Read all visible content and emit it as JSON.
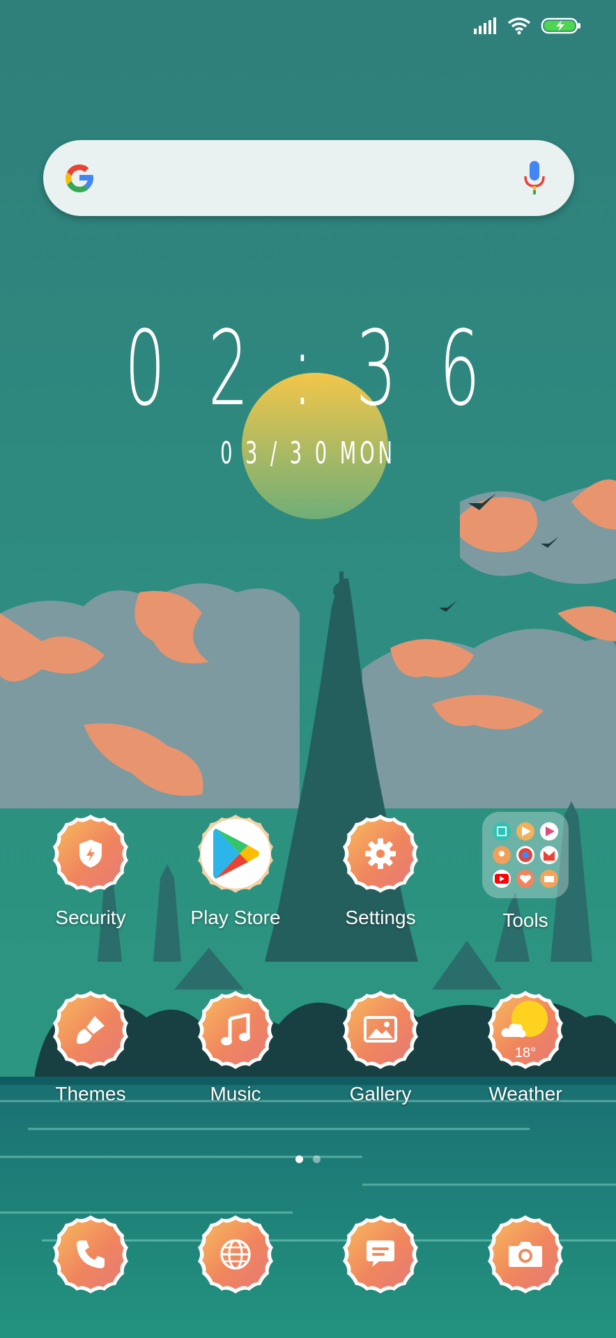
{
  "clock": {
    "time": "0 2 : 3 6",
    "date": "0 3 / 3 0  MON"
  },
  "apps": [
    {
      "label": "Security",
      "icon": "shield-icon"
    },
    {
      "label": "Play Store",
      "icon": "play-store-icon"
    },
    {
      "label": "Settings",
      "icon": "gear-icon"
    },
    {
      "label": "Tools",
      "icon": "folder-icon"
    },
    {
      "label": "Themes",
      "icon": "brush-icon"
    },
    {
      "label": "Music",
      "icon": "music-note-icon"
    },
    {
      "label": "Gallery",
      "icon": "image-icon"
    },
    {
      "label": "Weather",
      "icon": "sun-cloud-icon"
    }
  ],
  "weather": {
    "temp": "18°"
  },
  "dock": [
    {
      "icon": "phone-icon"
    },
    {
      "icon": "globe-icon"
    },
    {
      "icon": "message-icon"
    },
    {
      "icon": "camera-icon"
    }
  ],
  "colors": {
    "sky": "#2e8c80",
    "sea": "#1f8a7d",
    "cloud": "#e8956f",
    "icon_gradient": "#f4a35a"
  }
}
